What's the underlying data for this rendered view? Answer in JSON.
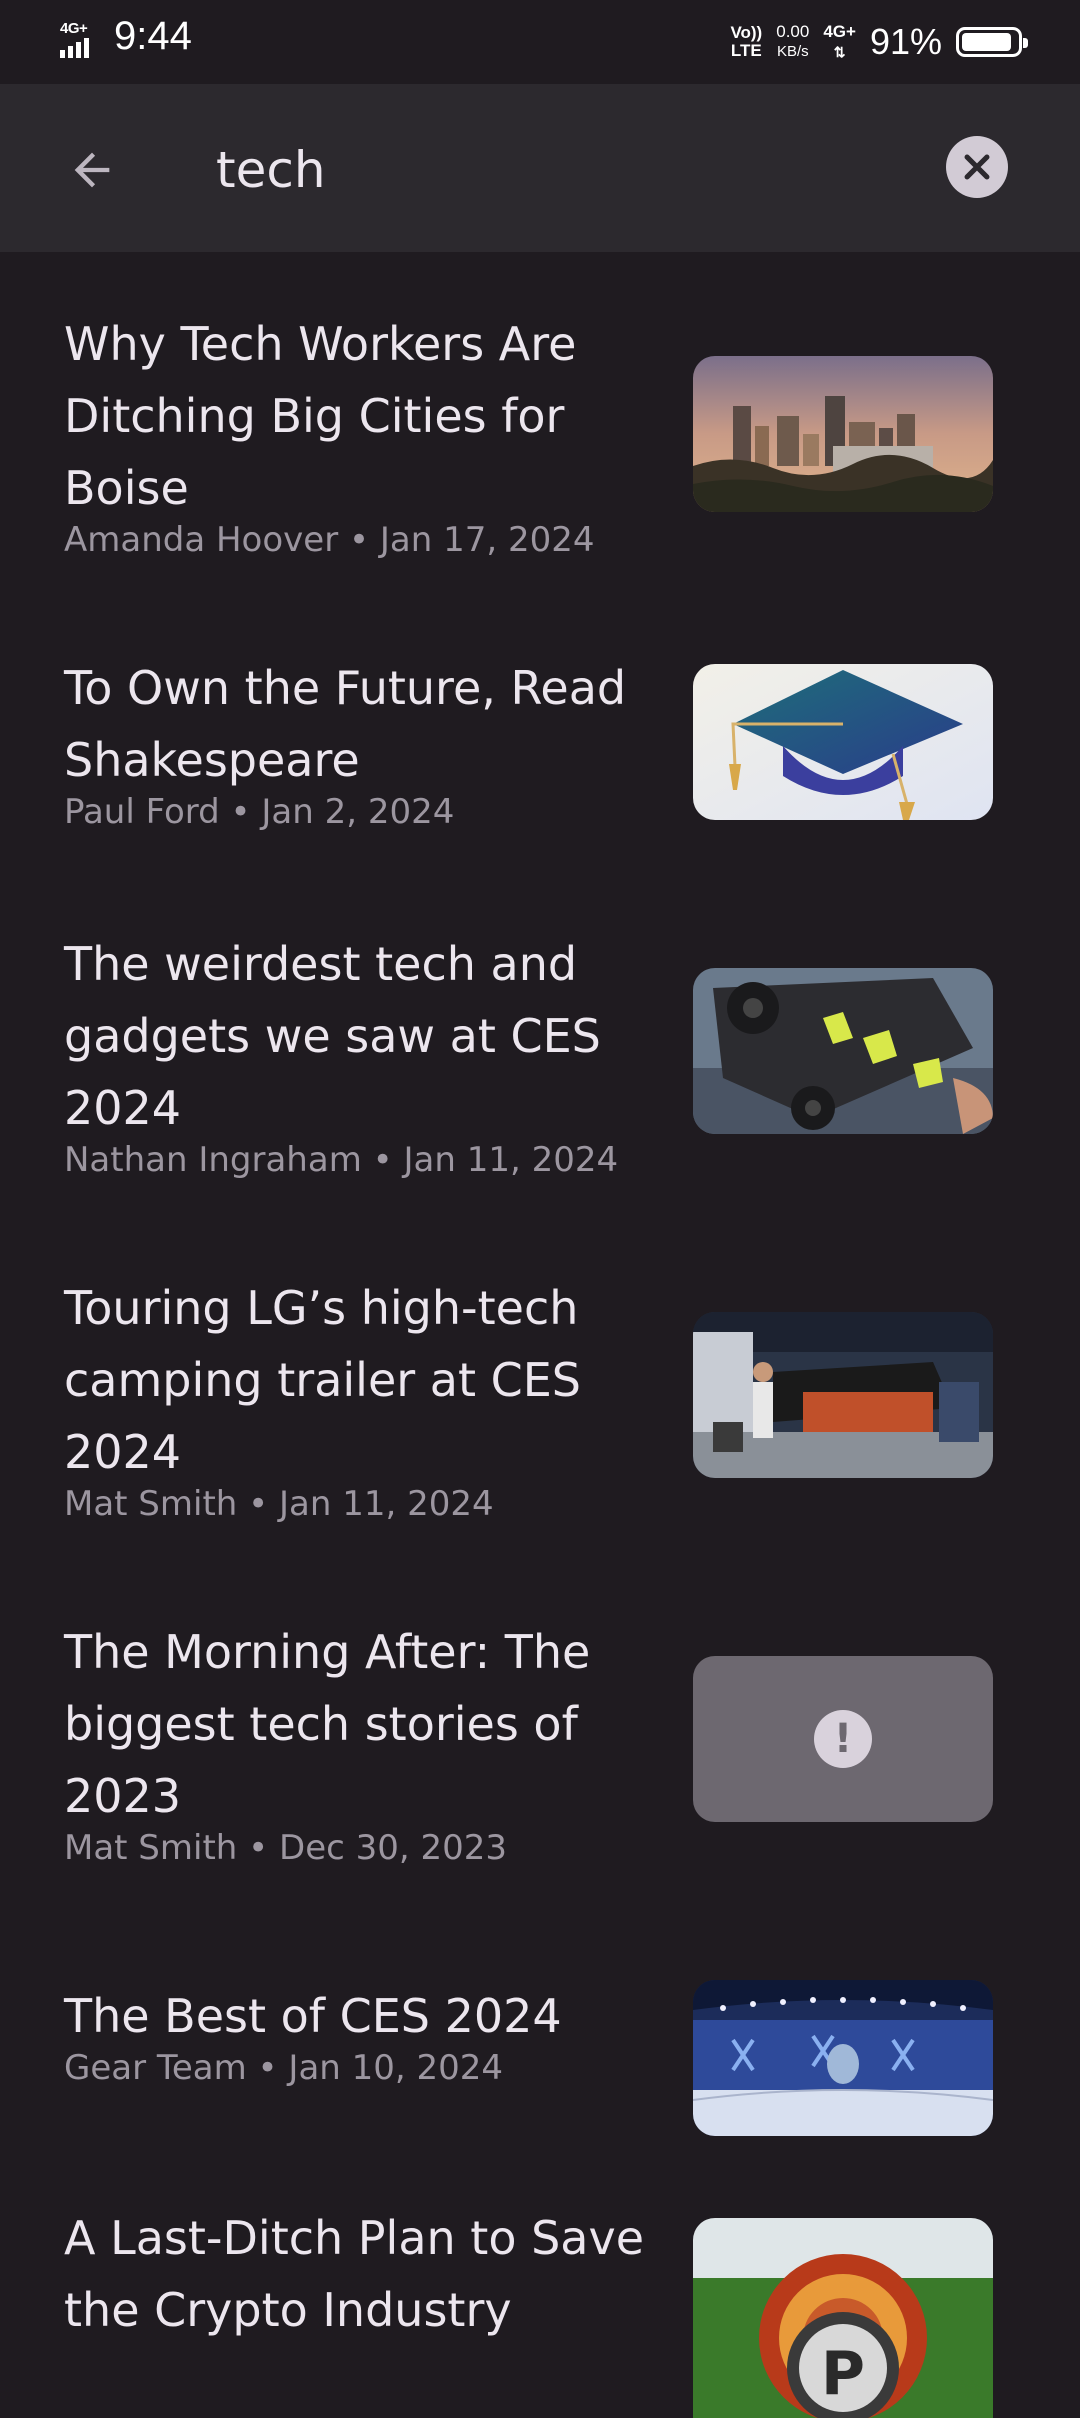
{
  "status_bar": {
    "network_type": "4G+",
    "time": "9:44",
    "volte_top": "Vo))",
    "volte_bottom": "LTE",
    "speed_value": "0.00",
    "speed_unit": "KB/s",
    "network_type_2": "4G+",
    "battery_percent": "91%",
    "battery_level": 0.91
  },
  "search": {
    "query": "tech",
    "back_icon": "arrow-left-icon",
    "clear_icon": "close-circle-icon"
  },
  "results": [
    {
      "title": "Why Tech Workers Are Ditching Big Cities for Boise",
      "author": "Amanda Hoover",
      "date": "Jan 17, 2024",
      "meta": "Amanda Hoover • Jan 17, 2024",
      "thumbnail": "city-skyline-image"
    },
    {
      "title": "To Own the Future, Read Shakespeare",
      "author": "Paul Ford",
      "date": "Jan 2, 2024",
      "meta": "Paul Ford • Jan 2, 2024",
      "thumbnail": "graduation-cap-image"
    },
    {
      "title": "The weirdest tech and gadgets we saw at CES 2024",
      "author": "Nathan Ingraham",
      "date": "Jan 11, 2024",
      "meta": "Nathan Ingraham • Jan 11, 2024",
      "thumbnail": "gadget-wheels-image"
    },
    {
      "title": "Touring LG’s high-tech camping trailer at CES 2024",
      "author": "Mat Smith",
      "date": "Jan 11, 2024",
      "meta": "Mat Smith • Jan 11, 2024",
      "thumbnail": "camping-trailer-image"
    },
    {
      "title": "The Morning After: The biggest tech stories of 2023",
      "author": "Mat Smith",
      "date": "Dec 30, 2023",
      "meta": "Mat Smith • Dec 30, 2023",
      "thumbnail": "image-error-icon"
    },
    {
      "title": "The Best of CES 2024",
      "author": "Gear Team",
      "date": "Jan 10, 2024",
      "meta": "Gear Team • Jan 10, 2024",
      "thumbnail": "ces-stage-image"
    },
    {
      "title": "A Last-Ditch Plan to Save the Crypto Industry",
      "thumbnail": "crypto-coin-image"
    }
  ],
  "colors": {
    "background": "#1f1b20",
    "header": "#2c292e",
    "title_text": "#ece6ee",
    "meta_text": "#9c96a0"
  }
}
